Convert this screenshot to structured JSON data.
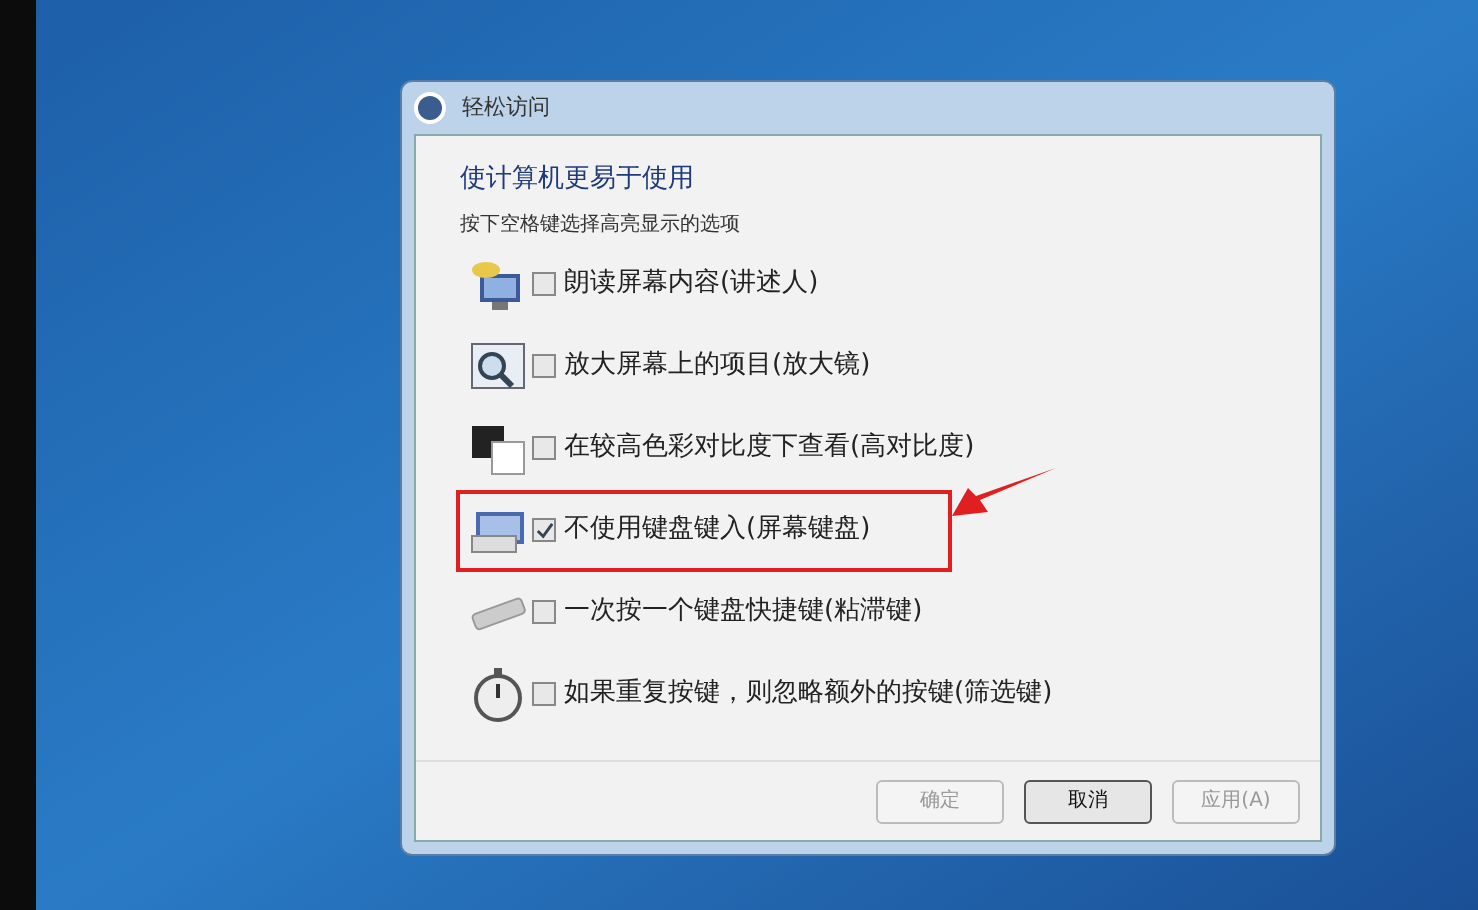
{
  "window": {
    "title": "轻松访问"
  },
  "heading": "使计算机更易于使用",
  "hint": "按下空格键选择高亮显示的选项",
  "options": [
    {
      "kind": "narrator",
      "label": "朗读屏幕内容(讲述人)",
      "checked": false,
      "highlighted": false
    },
    {
      "kind": "magnifier",
      "label": "放大屏幕上的项目(放大镜)",
      "checked": false,
      "highlighted": false
    },
    {
      "kind": "contrast",
      "label": "在较高色彩对比度下查看(高对比度)",
      "checked": false,
      "highlighted": false
    },
    {
      "kind": "keyboard",
      "label": "不使用键盘键入(屏幕键盘)",
      "checked": true,
      "highlighted": true
    },
    {
      "kind": "keys",
      "label": "一次按一个键盘快捷键(粘滞键)",
      "checked": false,
      "highlighted": false
    },
    {
      "kind": "timer",
      "label": "如果重复按键，则忽略额外的按键(筛选键)",
      "checked": false,
      "highlighted": false
    }
  ],
  "buttons": [
    {
      "label": "确定",
      "disabled": true
    },
    {
      "label": "取消",
      "disabled": false
    },
    {
      "label": "应用(A)",
      "disabled": true
    }
  ]
}
